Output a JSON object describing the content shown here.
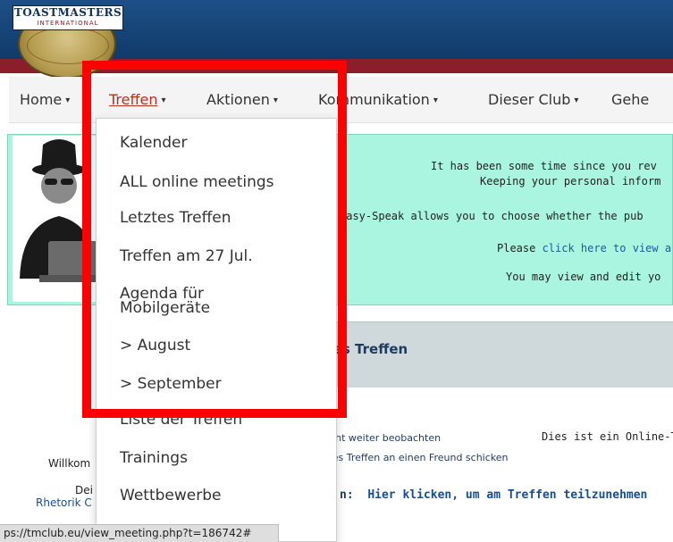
{
  "logo": {
    "line1": "TOASTMASTERS",
    "line2": "INTERNATIONAL"
  },
  "nav": {
    "items": [
      {
        "label": "Home",
        "caret": "▾"
      },
      {
        "label": "Treffen",
        "caret": "▾"
      },
      {
        "label": "Aktionen",
        "caret": "▾"
      },
      {
        "label": "Kommunikation",
        "caret": "▾"
      },
      {
        "label": "Dieser Club",
        "caret": "▾"
      },
      {
        "label": "Gehe",
        "caret": ""
      }
    ]
  },
  "dropdown": {
    "items": [
      {
        "label": "Kalender"
      },
      {
        "label": "ALL online meetings"
      },
      {
        "label": "Letztes Treffen"
      },
      {
        "label": "Treffen am 27 Jul."
      },
      {
        "label": "Agenda für",
        "label2": "Mobilgeräte"
      },
      {
        "label": "> August"
      },
      {
        "label": "> September"
      },
      {
        "label": "Liste der Treffen"
      },
      {
        "label": "Trainings"
      },
      {
        "label": "Wettbewerbe"
      }
    ]
  },
  "notice": {
    "line1": "It has been some time since you rev",
    "line2": "Keeping your personal inform",
    "line3": "easy-Speak allows you to choose whether the pub",
    "line4_prefix": "Please ",
    "line4_link": "click here to view ar",
    "line5": "You may view and edit yo"
  },
  "sidebar": {
    "welcome": "Willkom",
    "line2": "Dei",
    "link": "Rhetorik C"
  },
  "meeting": {
    "title": "ges Treffen",
    "unwatch": "icht weiter beobachten",
    "send": "ses Treffen an einen Freund schicken",
    "online_info": "Dies ist ein Online-T",
    "join_prefix": "n:",
    "join_link": "Hier klicken, um am Treffen teilzunehmen"
  },
  "status": {
    "url": "ps://tmclub.eu/view_meeting.php?t=186742#"
  },
  "colors": {
    "header": "#144173",
    "accent_red": "#ff0000",
    "notice_bg": "#aaf5df",
    "active_nav": "#b4331f"
  }
}
